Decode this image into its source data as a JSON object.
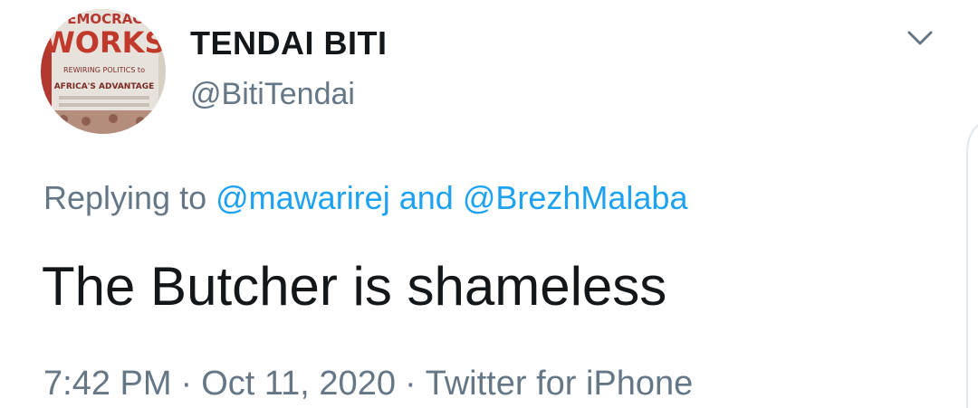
{
  "tweet": {
    "author": {
      "display_name": "TENDAI BITI",
      "handle": "@BitiTendai",
      "avatar": {
        "line1": "DEMOCRACY",
        "line2": "WORKS",
        "line3": "REWIRING POLITICS to",
        "line4": "AFRICA'S ADVANTAGE"
      }
    },
    "reply": {
      "prefix": "Replying to",
      "mention1": "@mawarirej",
      "conjunction": "and",
      "mention2": "@BrezhMalaba"
    },
    "text": "The Butcher is shameless",
    "time": "7:42 PM",
    "separator": "·",
    "date": "Oct 11, 2020",
    "source": "Twitter for iPhone"
  },
  "icons": {
    "menu": "chevron-down-icon"
  },
  "colors": {
    "text_primary": "#14171a",
    "text_secondary": "#657786",
    "link": "#1da1f2",
    "background": "#ffffff"
  }
}
